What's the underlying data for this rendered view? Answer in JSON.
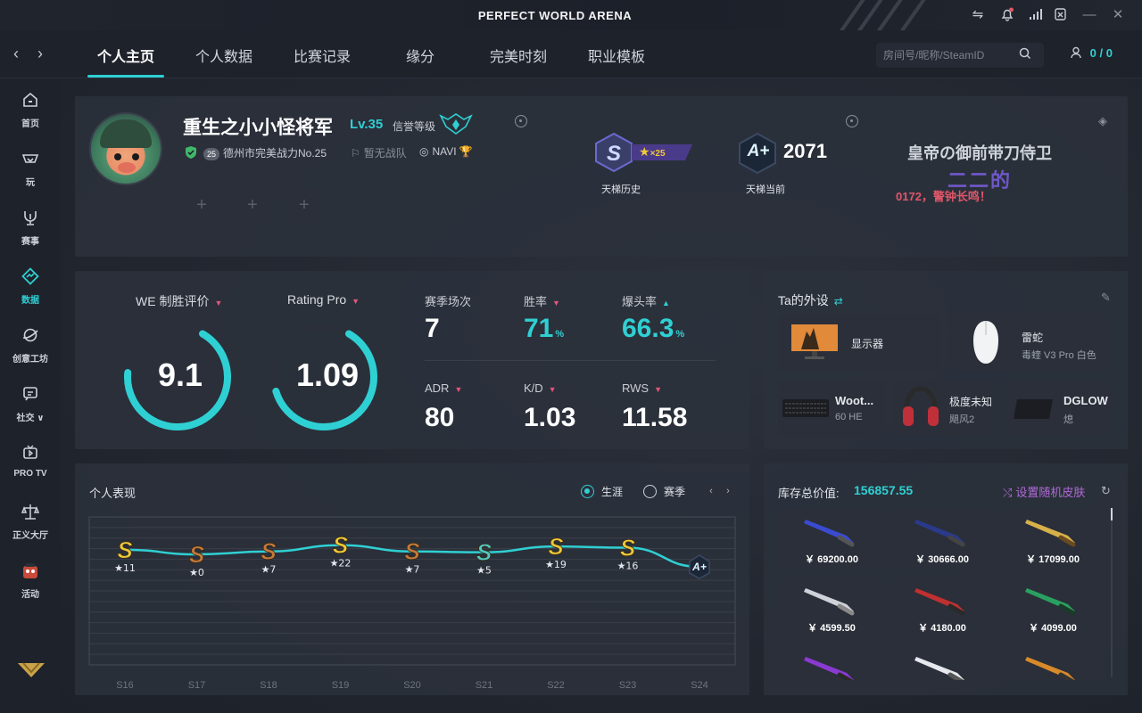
{
  "window": {
    "title": "PERFECT WORLD ARENA"
  },
  "nav": {
    "tabs": [
      "个人主页",
      "个人数据",
      "比赛记录",
      "缘分",
      "完美时刻",
      "职业模板"
    ],
    "search_placeholder": "房间号/昵称/SteamID",
    "friends_count": "0 / 0"
  },
  "sidebar": {
    "items": [
      {
        "label": "首页",
        "icon": "home-icon"
      },
      {
        "label": "玩",
        "icon": "gamepad-icon"
      },
      {
        "label": "赛事",
        "icon": "trophy-icon"
      },
      {
        "label": "数据",
        "icon": "data-icon"
      },
      {
        "label": "创意工坊",
        "icon": "workshop-icon"
      },
      {
        "label": "社交 ∨",
        "icon": "social-icon"
      },
      {
        "label": "PRO TV",
        "icon": "tv-icon"
      },
      {
        "label": "正义大厅",
        "icon": "justice-icon"
      },
      {
        "label": "活动",
        "icon": "event-icon"
      }
    ],
    "active_index": 3
  },
  "profile": {
    "name": "重生之小小怪将军",
    "level": "Lv.35",
    "honor_label": "信誉等级",
    "rank_badge": "25",
    "city_rank": "德州市完美战力No.25",
    "team": "暂无战队",
    "fav_team": "NAVI",
    "ladder_history_stars": "×25",
    "ladder_history_label": "天梯历史",
    "ladder_current_grade": "A+",
    "ladder_current_score": "2071",
    "ladder_current_label": "天梯当前",
    "title_line1": "皇帝の御前带刀侍卫",
    "title_line2": "二二的",
    "title_line3": "0172，警钟长鸣！"
  },
  "stats": {
    "we_label": "WE 制胜评价",
    "we_value": "9.1",
    "we_fraction": 0.68,
    "rating_label": "Rating Pro",
    "rating_value": "1.09",
    "rating_fraction": 0.62,
    "matches_label": "赛季场次",
    "matches_value": "7",
    "winrate_label": "胜率",
    "winrate_value": "71",
    "hs_label": "爆头率",
    "hs_value": "66.3",
    "percent": "%",
    "adr_label": "ADR",
    "adr_value": "80",
    "kd_label": "K/D",
    "kd_value": "1.03",
    "rws_label": "RWS",
    "rws_value": "11.58"
  },
  "gear": {
    "title": "Ta的外设",
    "items": [
      {
        "name": "显示器",
        "sub": ""
      },
      {
        "name": "雷蛇",
        "sub": "毒蝰 V3 Pro 白色"
      },
      {
        "name": "Woot...",
        "sub": "60 HE"
      },
      {
        "name": "极度未知",
        "sub": "飓风2"
      },
      {
        "name": "DGLOW",
        "sub": "熄"
      }
    ]
  },
  "performance": {
    "title": "个人表现",
    "radio_career": "生涯",
    "radio_season": "赛季",
    "selected": "生涯"
  },
  "chart_data": {
    "type": "line",
    "x": [
      "S16",
      "S17",
      "S18",
      "S19",
      "S20",
      "S21",
      "S22",
      "S23",
      "S24"
    ],
    "series": [
      {
        "grades": [
          "S",
          "S",
          "S",
          "S",
          "S",
          "S",
          "S",
          "S",
          "A+"
        ],
        "stars": [
          "★11",
          "★0",
          "★7",
          "★22",
          "★7",
          "★5",
          "★19",
          "★16",
          ""
        ],
        "values": [
          11,
          0,
          7,
          22,
          7,
          5,
          19,
          16,
          0
        ]
      }
    ],
    "colors": {
      "line": "#2fd0d3",
      "gold": "#f0c93a",
      "bronze": "#c47a3c",
      "teal": "#4fc9c4"
    },
    "grade_colors": [
      "gold",
      "bronze",
      "bronze",
      "gold",
      "bronze",
      "teal",
      "gold",
      "gold",
      "dark"
    ],
    "grid": true
  },
  "inventory": {
    "title": "库存总价值:",
    "value": "156857.55",
    "random_label": "设置随机皮肤",
    "items": [
      {
        "price": "￥ 69200.00",
        "kind": "knife-blue"
      },
      {
        "price": "￥ 30666.00",
        "kind": "knife-dark"
      },
      {
        "price": "￥ 17099.00",
        "kind": "rifle-gold"
      },
      {
        "price": "￥ 4599.50",
        "kind": "pistol-silver"
      },
      {
        "price": "￥ 4180.00",
        "kind": "knife-red"
      },
      {
        "price": "￥ 4099.00",
        "kind": "pistol-green"
      },
      {
        "price": "",
        "kind": "sniper-purple"
      },
      {
        "price": "",
        "kind": "rifle-white"
      },
      {
        "price": "",
        "kind": "knife-orange"
      }
    ]
  },
  "colors": {
    "accent": "#2fd0d3",
    "background": "#1b1f27",
    "panel": "#2c313c",
    "danger": "#e0566a",
    "purple": "#6f58c9"
  }
}
